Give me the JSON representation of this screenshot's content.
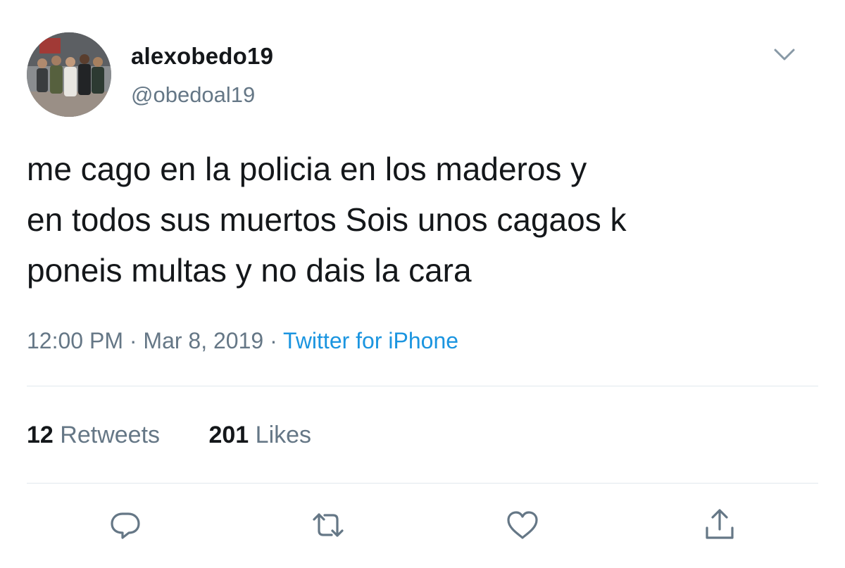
{
  "user": {
    "display_name": "alexobedo19",
    "handle": "@obedoal19",
    "avatar": "group-photo-avatar"
  },
  "tweet": {
    "text": "me cago en la policia en los maderos y\nen todos sus muertos Sois unos cagaos k\nponeis multas y no dais la cara",
    "time": "12:00 PM",
    "date": "Mar 8, 2019",
    "separator": "·",
    "source": "Twitter for iPhone"
  },
  "stats": {
    "retweets_count": "12",
    "retweets_label": "Retweets",
    "likes_count": "201",
    "likes_label": "Likes"
  },
  "icons": {
    "menu": "chevron-down-icon",
    "reply": "reply-icon",
    "retweet": "retweet-icon",
    "like": "heart-icon",
    "share": "share-icon"
  },
  "colors": {
    "text": "#14171a",
    "secondary": "#657786",
    "link": "#1b95e0",
    "divider": "#e1e8ed"
  }
}
